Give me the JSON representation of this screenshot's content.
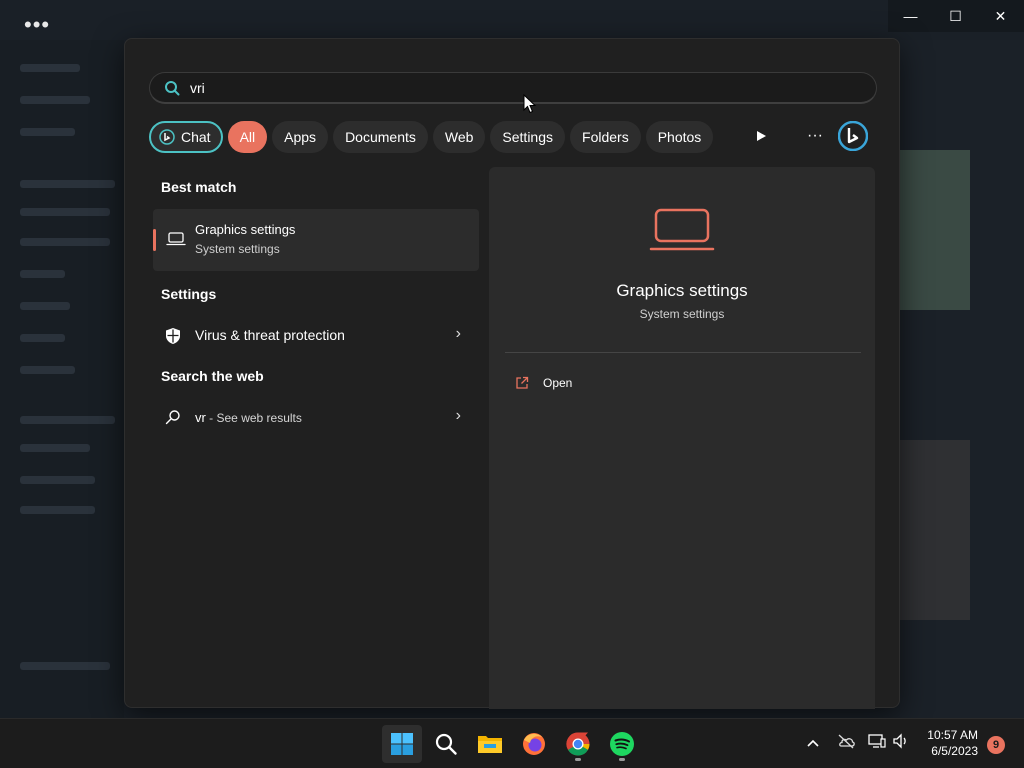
{
  "window": {
    "more_glyph": "•••",
    "minimize_glyph": "—",
    "maximize_glyph": "☐",
    "close_glyph": "✕"
  },
  "search": {
    "value": "vri",
    "placeholder": ""
  },
  "filters": {
    "chat": "Chat",
    "items": [
      "All",
      "Apps",
      "Documents",
      "Web",
      "Settings",
      "Folders",
      "Photos"
    ],
    "active": "All",
    "more_glyph": "···"
  },
  "best_match": {
    "heading": "Best match",
    "title": "Graphics settings",
    "subtitle": "System settings"
  },
  "settings_section": {
    "heading": "Settings",
    "item": "Virus & threat protection"
  },
  "web_section": {
    "heading": "Search the web",
    "query": "vr",
    "suffix": " - See web results"
  },
  "detail": {
    "title": "Graphics settings",
    "subtitle": "System settings",
    "open_label": "Open"
  },
  "taskbar": {
    "time": "10:57 AM",
    "date": "6/5/2023",
    "notification_count": "9"
  },
  "colors": {
    "accent": "#e9735f",
    "chat_border": "#4cc2c4",
    "panel_bg": "#202020",
    "pane_bg": "#2b2b2b"
  }
}
